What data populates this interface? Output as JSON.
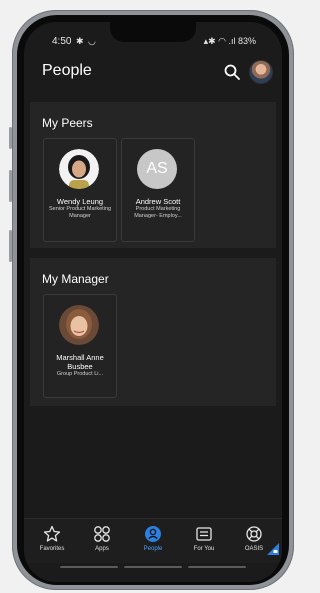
{
  "status": {
    "time": "4:50",
    "left_icons": "✱ ◡",
    "right_icons": "▴✱ ◠ .ıl 83%"
  },
  "header": {
    "title": "People"
  },
  "peers": {
    "title": "My Peers",
    "people": [
      {
        "name": "Wendy Leung",
        "role": "Senior Product Marketing Manager"
      },
      {
        "name": "Andrew Scott",
        "role": "Product Marketing Manager- Employ...",
        "initials": "AS"
      }
    ]
  },
  "manager": {
    "title": "My Manager",
    "people": [
      {
        "name": "Marshall Anne Busbee",
        "role": "Group Product Li..."
      }
    ]
  },
  "nav": {
    "items": [
      {
        "label": "Favorites",
        "icon": "star-icon"
      },
      {
        "label": "Apps",
        "icon": "apps-icon"
      },
      {
        "label": "People",
        "icon": "people-icon"
      },
      {
        "label": "For You",
        "icon": "for-you-icon"
      },
      {
        "label": "OASIS",
        "icon": "lifebuoy-icon"
      }
    ],
    "active": "People"
  },
  "colors": {
    "accent": "#4aa0ff",
    "background": "#1b1b1b",
    "section": "#252525"
  }
}
